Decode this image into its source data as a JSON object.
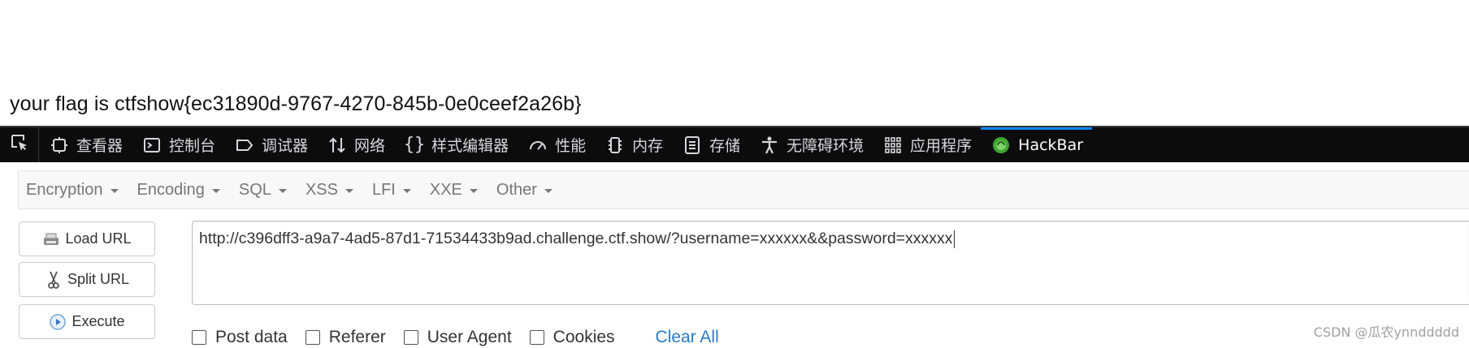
{
  "page": {
    "flag_text": "your flag is ctfshow{ec31890d-9767-4270-845b-0e0ceef2a26b}"
  },
  "devtools": {
    "picker_icon": "element-picker-icon",
    "tabs": [
      {
        "label": "查看器",
        "icon": "inspector-icon"
      },
      {
        "label": "控制台",
        "icon": "console-icon"
      },
      {
        "label": "调试器",
        "icon": "debugger-icon"
      },
      {
        "label": "网络",
        "icon": "network-icon"
      },
      {
        "label": "样式编辑器",
        "icon": "style-editor-icon"
      },
      {
        "label": "性能",
        "icon": "performance-icon"
      },
      {
        "label": "内存",
        "icon": "memory-icon"
      },
      {
        "label": "存储",
        "icon": "storage-icon"
      },
      {
        "label": "无障碍环境",
        "icon": "accessibility-icon"
      },
      {
        "label": "应用程序",
        "icon": "application-icon"
      },
      {
        "label": "HackBar",
        "icon": "hackbar-icon",
        "active": true
      }
    ],
    "colors": {
      "background": "#0c0c0d",
      "text": "#d7d7db",
      "active_accent": "#0a84ff"
    }
  },
  "hackbar": {
    "menu": [
      "Encryption",
      "Encoding",
      "SQL",
      "XSS",
      "LFI",
      "XXE",
      "Other"
    ],
    "buttons": {
      "load_url": "Load URL",
      "split_url": "Split URL",
      "execute": "Execute"
    },
    "url_value": "http://c396dff3-a9a7-4ad5-87d1-71534433b9ad.challenge.ctf.show/?username=xxxxxx&&password=xxxxxx",
    "options": {
      "post_data": "Post data",
      "referer": "Referer",
      "user_agent": "User Agent",
      "cookies": "Cookies"
    },
    "clear_all": "Clear All"
  },
  "watermark": "CSDN @瓜农ynnddddd"
}
